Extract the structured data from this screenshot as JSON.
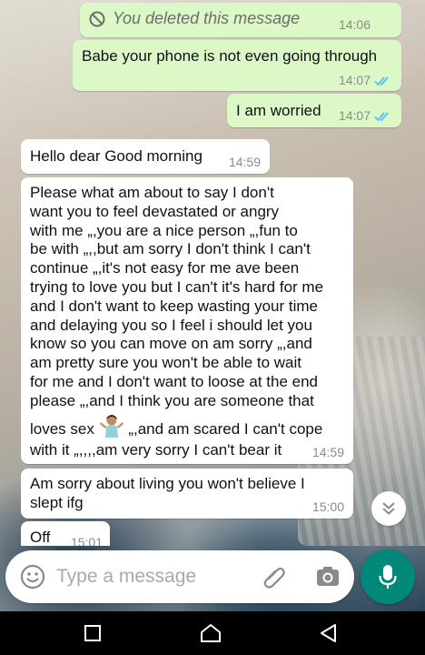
{
  "colors": {
    "outgoing_bubble": "#dcf8c6",
    "incoming_bubble": "#ffffff",
    "read_ticks": "#4fc3f7",
    "accent": "#00897b"
  },
  "messages": [
    {
      "direction": "out",
      "deleted": true,
      "text": "You deleted this message",
      "time": "14:06"
    },
    {
      "direction": "out",
      "text": "Babe your phone is not even going through",
      "time": "14:07",
      "status": "read-double-tick"
    },
    {
      "direction": "out",
      "text": "I am worried",
      "time": "14:07",
      "status": "read-double-tick"
    },
    {
      "direction": "in",
      "text": "Hello dear Good morning",
      "time": "14:59"
    },
    {
      "direction": "in",
      "lines": [
        "Please what am about to say I don't",
        "want you to feel devastated or angry",
        "with me „,you are a nice person „,fun to",
        "be with „,,but am sorry I don't think I can't",
        "continue „,it's not easy for me ave been",
        "trying to love you but I can't it's hard for me",
        "and I don't want to keep wasting your time",
        "and delaying you so I feel i should let you",
        "know so you can move on am sorry „,and",
        "am pretty sure you won't be able to wait",
        "for me and I don't want to loose at the end",
        "please „,and I think you are someone that",
        "loves sex",
        " „,and am scared I can't cope",
        "with it „,,,,am very sorry I can't bear it"
      ],
      "emoji": "person-shrugging-emoji",
      "time": "14:59"
    },
    {
      "direction": "in",
      "text": "Am sorry about living you won't believe I\nslept ifg",
      "time": "15:00"
    },
    {
      "direction": "in",
      "text": "Off",
      "time": "15:01"
    }
  ],
  "composer": {
    "placeholder": "Type a message",
    "emoji_icon": "emoji-icon",
    "attach_icon": "paperclip-icon",
    "camera_icon": "camera-icon",
    "mic_icon": "microphone-icon"
  },
  "scroll_button_icon": "double-chevron-down-icon",
  "navbar": {
    "recents_icon": "square-icon",
    "home_icon": "home-icon",
    "back_icon": "triangle-back-icon"
  }
}
